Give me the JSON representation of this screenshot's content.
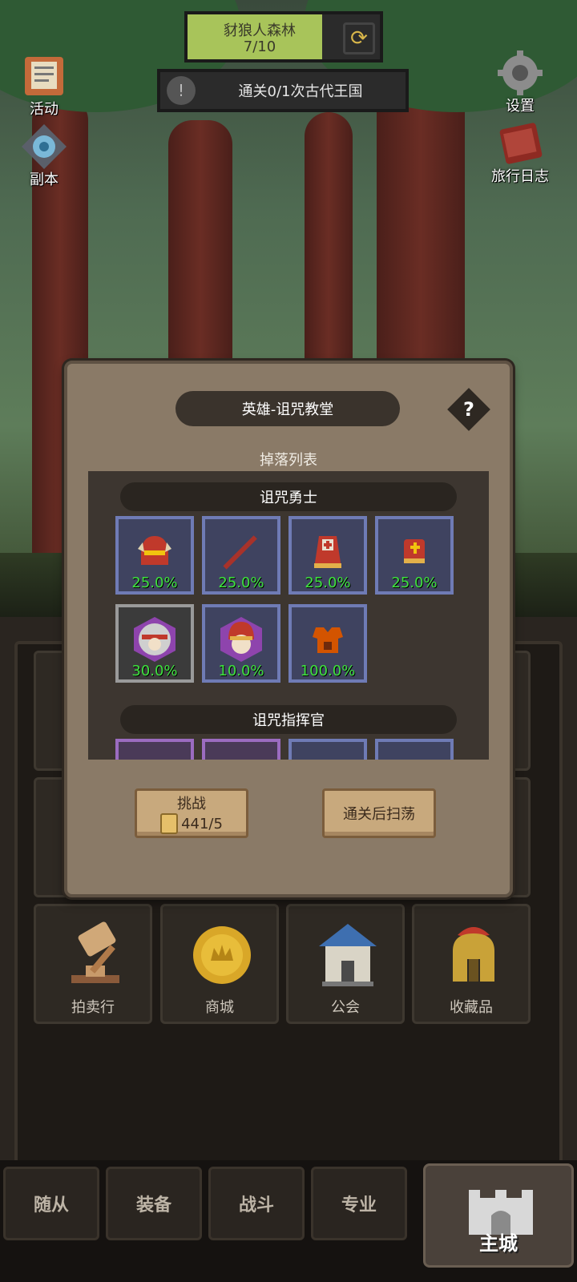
{
  "hud": {
    "stage_name": "豺狼人森林",
    "stage_progress": "7/10",
    "stage_progress_fraction": 0.7,
    "quest_text": "通关0/1次古代王国"
  },
  "side_left": [
    {
      "label": "活动",
      "icon": "activity-scroll-icon"
    },
    {
      "label": "副本",
      "icon": "dungeon-portal-icon"
    }
  ],
  "side_right": [
    {
      "label": "设置",
      "icon": "gear-icon"
    },
    {
      "label": "旅行日志",
      "icon": "journal-book-icon"
    }
  ],
  "dialog": {
    "title": "英雄-诅咒教堂",
    "help": "?",
    "drop_list_label": "掉落列表",
    "groups": [
      {
        "name": "诅咒勇士",
        "items": [
          {
            "icon": "helmet-icon",
            "rarity": "blue",
            "chance": "25.0%"
          },
          {
            "icon": "staff-icon",
            "rarity": "blue",
            "chance": "25.0%"
          },
          {
            "icon": "robe-icon",
            "rarity": "blue",
            "chance": "25.0%"
          },
          {
            "icon": "glove-icon",
            "rarity": "blue",
            "chance": "25.0%"
          },
          {
            "icon": "hero-portrait-hooded-icon",
            "rarity": "gray",
            "chance": "30.0%"
          },
          {
            "icon": "hero-portrait-warrior-icon",
            "rarity": "blue",
            "chance": "10.0%"
          },
          {
            "icon": "armor-icon",
            "rarity": "blue",
            "chance": "100.0%"
          }
        ]
      },
      {
        "name": "诅咒指挥官",
        "items": [
          {
            "rarity": "purple"
          },
          {
            "rarity": "purple"
          },
          {
            "rarity": "blue"
          },
          {
            "rarity": "blue"
          }
        ]
      }
    ],
    "challenge_button": {
      "label": "挑战",
      "cost": "441/5"
    },
    "sweep_button": {
      "label": "通关后扫荡"
    }
  },
  "buildings": [
    {
      "label": "拍卖行",
      "icon": "gavel-icon"
    },
    {
      "label": "商城",
      "icon": "gold-coin-icon"
    },
    {
      "label": "公会",
      "icon": "guild-house-icon"
    },
    {
      "label": "收藏品",
      "icon": "spartan-helmet-icon"
    }
  ],
  "bottom_nav": {
    "tabs": [
      "随从",
      "装备",
      "战斗",
      "专业"
    ],
    "main": "主城"
  }
}
